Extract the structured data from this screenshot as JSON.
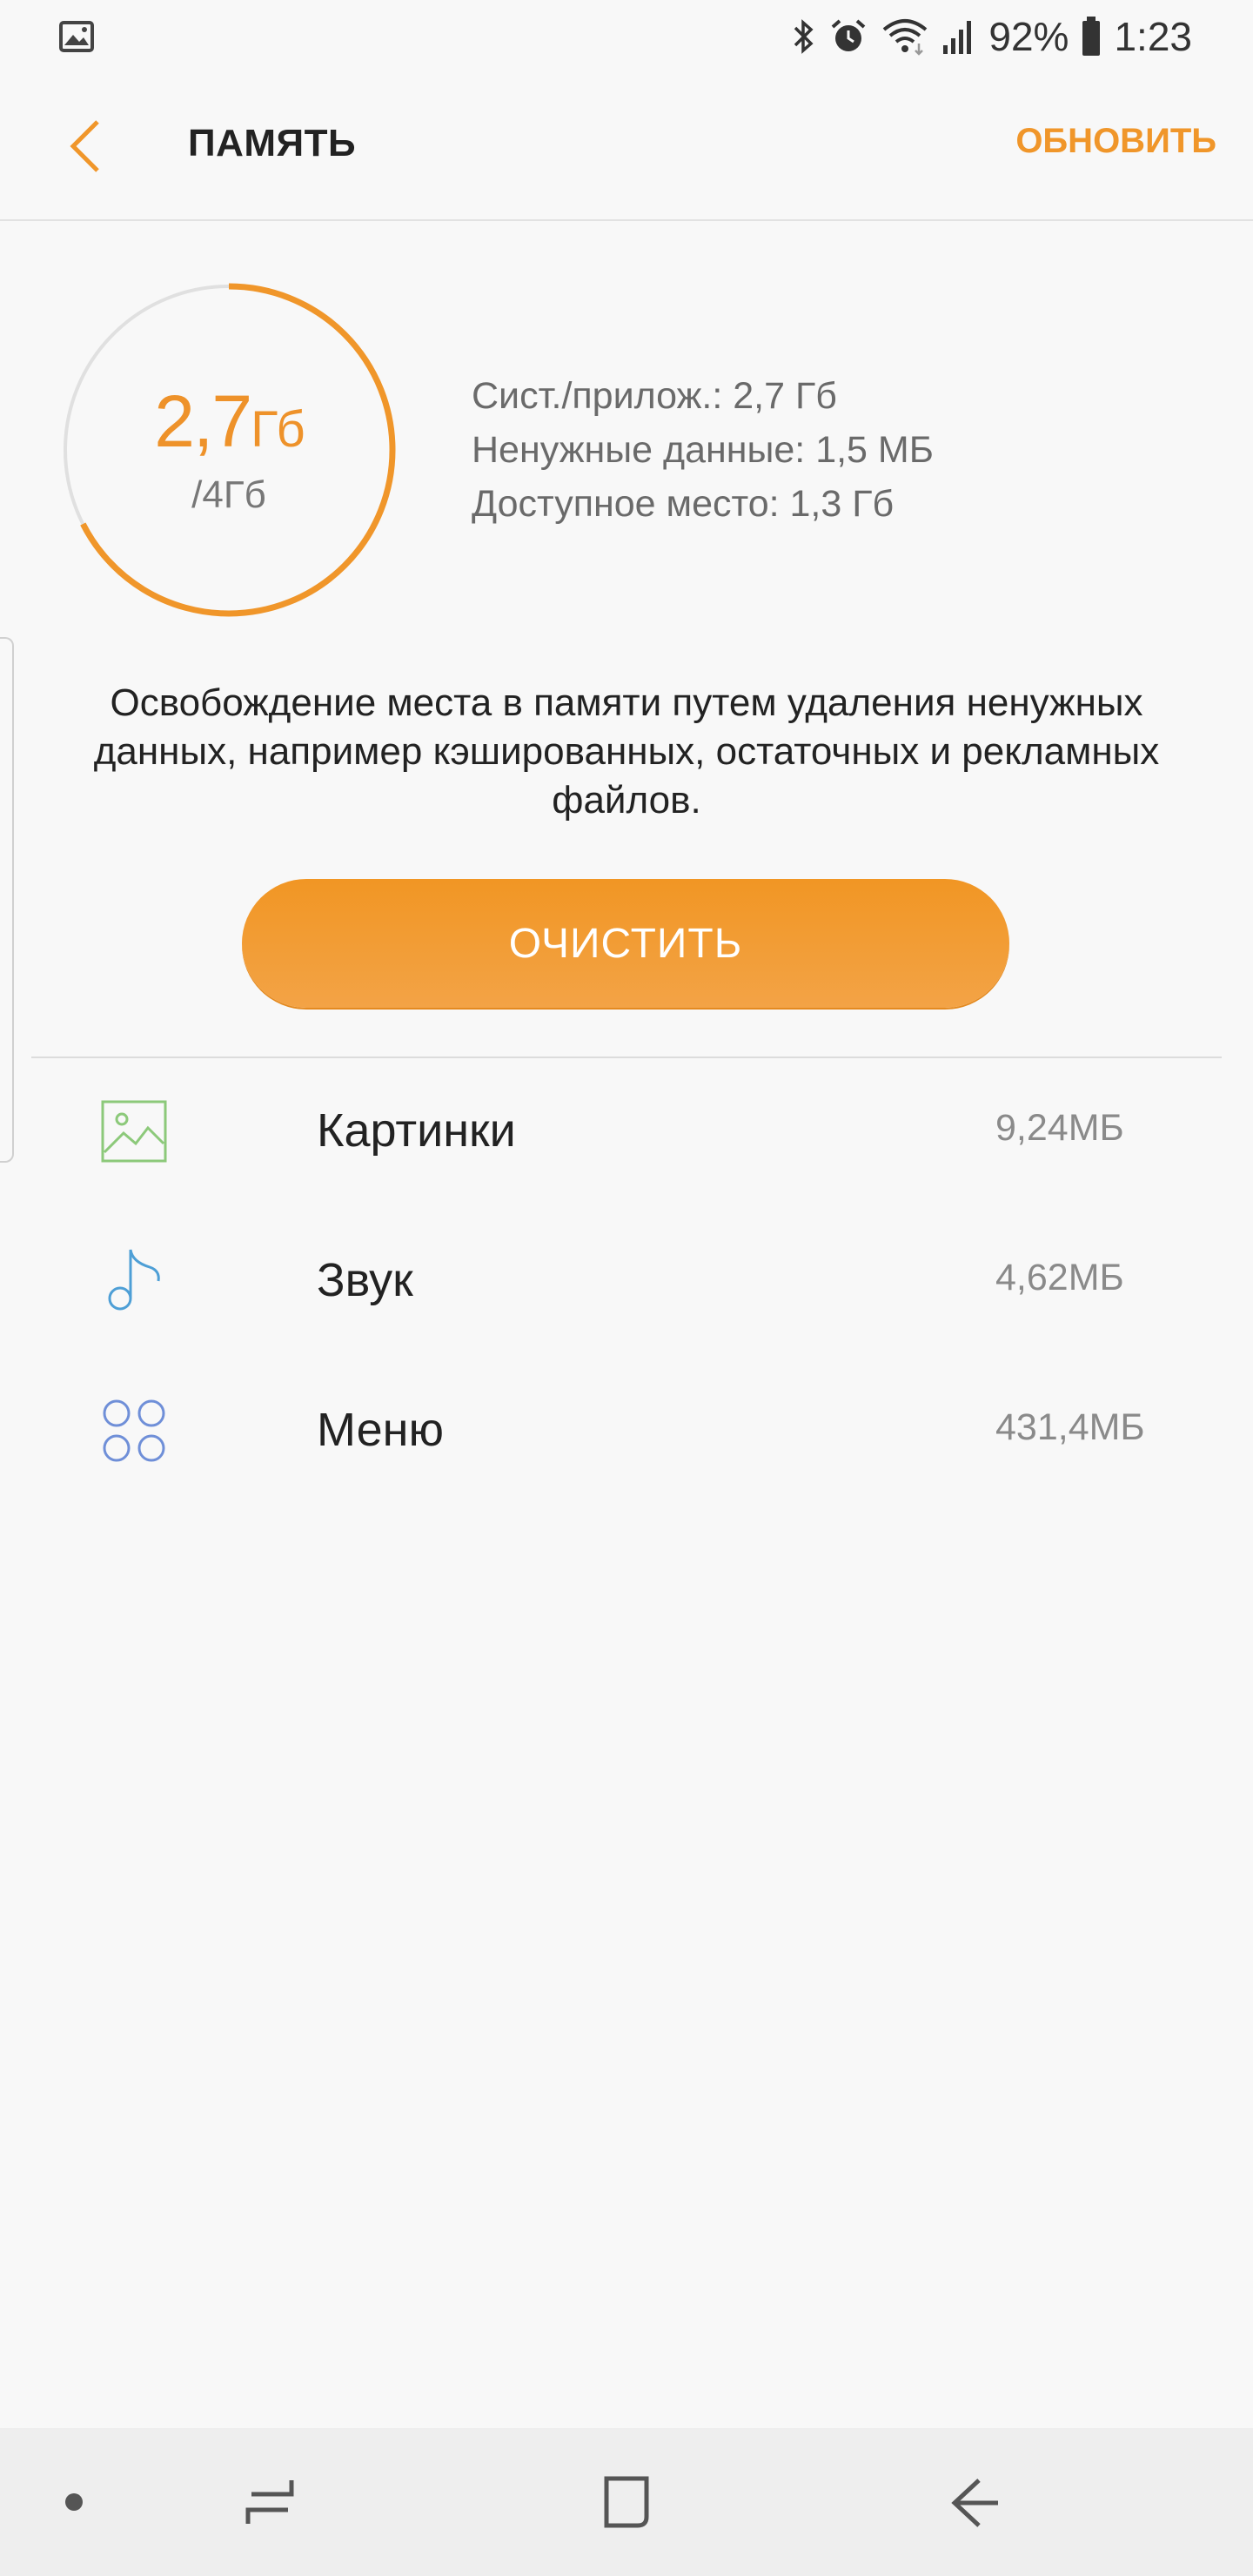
{
  "status_bar": {
    "battery": "92%",
    "time": "1:23",
    "left_icon": "image-notification-icon",
    "right_icons": [
      "bluetooth-icon",
      "alarm-icon",
      "wifi-icon",
      "signal-icon",
      "battery-icon"
    ]
  },
  "header": {
    "title": "ПАМЯТЬ",
    "refresh_label": "ОБНОВИТЬ",
    "back_icon": "chevron-left-icon"
  },
  "storage": {
    "used_value": "2,7",
    "used_unit": "Гб",
    "total": "/4Гб",
    "used_fraction": 0.675,
    "stats": [
      "Сист./прилож.: 2,7 Гб",
      "Ненужные данные: 1,5 МБ",
      "Доступное место: 1,3 Гб"
    ]
  },
  "description": "Освобождение места в памяти путем удаления ненужных данных, например кэшированных, остаточных и рекламных файлов.",
  "clean_button": "ОЧИСТИТЬ",
  "categories": [
    {
      "label": "Картинки",
      "size": "9,24МБ",
      "icon": "image-icon"
    },
    {
      "label": "Звук",
      "size": "4,62МБ",
      "icon": "music-note-icon"
    },
    {
      "label": "Меню",
      "size": "431,4МБ",
      "icon": "apps-grid-icon"
    }
  ],
  "colors": {
    "accent": "#F0962A",
    "image_icon": "#8CC97A",
    "audio_icon": "#4E9FD6",
    "apps_icon": "#6F8FD8"
  },
  "nav_bar": {
    "buttons": [
      "dot-icon",
      "recent-apps-icon",
      "home-icon",
      "back-icon"
    ]
  }
}
